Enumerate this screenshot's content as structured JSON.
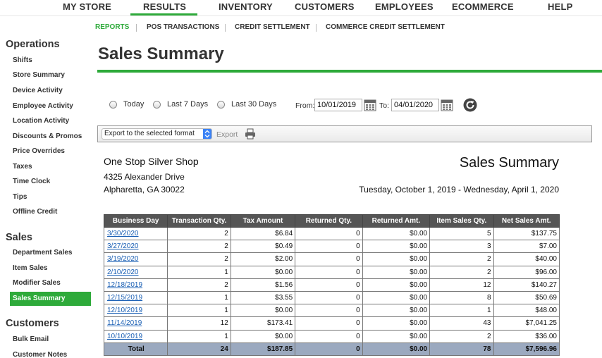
{
  "topnav": {
    "items": [
      "MY STORE",
      "RESULTS",
      "INVENTORY",
      "CUSTOMERS",
      "EMPLOYEES",
      "ECOMMERCE",
      "HELP"
    ],
    "active": "RESULTS"
  },
  "subnav": {
    "items": [
      "REPORTS",
      "POS TRANSACTIONS",
      "CREDIT SETTLEMENT",
      "COMMERCE CREDIT SETTLEMENT"
    ],
    "active": "REPORTS"
  },
  "sidebar": {
    "sections": [
      {
        "heading": "Operations",
        "items": [
          "Shifts",
          "Store Summary",
          "Device Activity",
          "Employee Activity",
          "Location Activity",
          "Discounts & Promos",
          "Price Overrides",
          "Taxes",
          "Time Clock",
          "Tips",
          "Offline Credit"
        ]
      },
      {
        "heading": "Sales",
        "items": [
          "Department Sales",
          "Item Sales",
          "Modifier Sales",
          "Sales Summary"
        ]
      },
      {
        "heading": "Customers",
        "items": [
          "Bulk Email",
          "Customer Notes"
        ]
      }
    ],
    "active_item": "Sales Summary"
  },
  "page": {
    "title": "Sales Summary"
  },
  "filters": {
    "radios": [
      "Today",
      "Last 7 Days",
      "Last 30 Days"
    ],
    "from_label": "From:",
    "from_value": "10/01/2019",
    "to_label": "To:",
    "to_value": "04/01/2020"
  },
  "export": {
    "select_value": "Export to the selected format",
    "button_label": "Export"
  },
  "report": {
    "shop_name": "One Stop Silver Shop",
    "address_line1": "4325 Alexander Drive",
    "address_line2": "Alpharetta, GA 30022",
    "title": "Sales Summary",
    "date_range": "Tuesday, October 1, 2019 - Wednesday, April 1, 2020"
  },
  "table": {
    "headers": [
      "Business Day",
      "Transaction Qty.",
      "Tax Amount",
      "Returned Qty.",
      "Returned Amt.",
      "Item Sales Qty.",
      "Net Sales Amt."
    ],
    "rows": [
      [
        "3/30/2020",
        "2",
        "$6.84",
        "0",
        "$0.00",
        "5",
        "$137.75"
      ],
      [
        "3/27/2020",
        "2",
        "$0.49",
        "0",
        "$0.00",
        "3",
        "$7.00"
      ],
      [
        "3/19/2020",
        "2",
        "$2.00",
        "0",
        "$0.00",
        "2",
        "$40.00"
      ],
      [
        "2/10/2020",
        "1",
        "$0.00",
        "0",
        "$0.00",
        "2",
        "$96.00"
      ],
      [
        "12/18/2019",
        "2",
        "$1.56",
        "0",
        "$0.00",
        "12",
        "$140.27"
      ],
      [
        "12/15/2019",
        "1",
        "$3.55",
        "0",
        "$0.00",
        "8",
        "$50.69"
      ],
      [
        "12/10/2019",
        "1",
        "$0.00",
        "0",
        "$0.00",
        "1",
        "$48.00"
      ],
      [
        "11/14/2019",
        "12",
        "$173.41",
        "0",
        "$0.00",
        "43",
        "$7,041.25"
      ],
      [
        "10/10/2019",
        "1",
        "$0.00",
        "0",
        "$0.00",
        "2",
        "$36.00"
      ]
    ],
    "total": [
      "Total",
      "24",
      "$187.85",
      "0",
      "$0.00",
      "78",
      "$7,596.96"
    ]
  },
  "colors": {
    "accent": "#2eaa3a",
    "header_bg": "#555555",
    "total_bg": "#9ba9bf",
    "link": "#1a5fb4"
  },
  "icons": [
    "calendar-icon",
    "refresh-icon",
    "print-icon",
    "chevron-down-icon"
  ]
}
